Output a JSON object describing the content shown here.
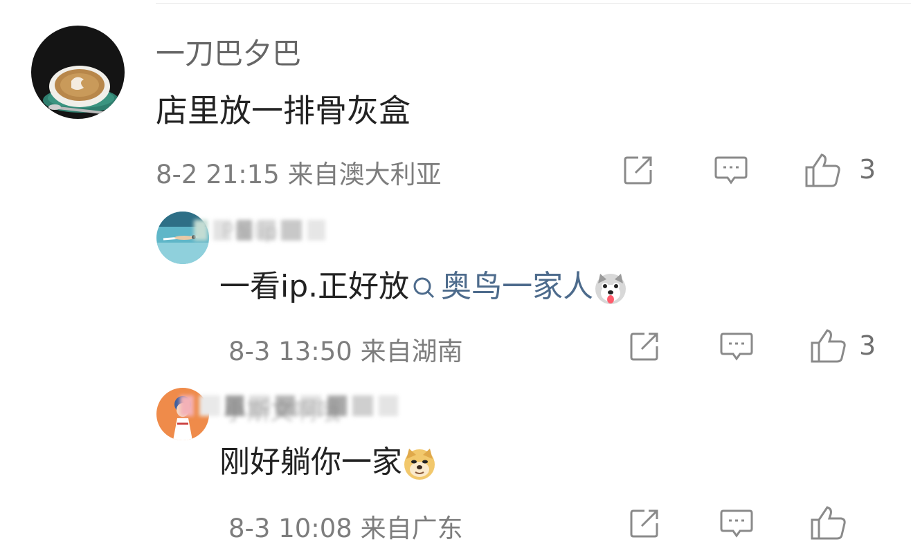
{
  "comments": [
    {
      "username": "一刀巴夕巴",
      "text": "店里放一排骨灰盒",
      "meta": "8-2 21:15 来自澳大利亚",
      "likes": "3",
      "avatar_icon": "coffee-latte-art-icon"
    },
    {
      "username": "Philip",
      "text_before": "一看ip.正好放",
      "search_term": "奥鸟一家人",
      "emoji_icon": "husky-dog-emoji-icon",
      "meta": "8-3 13:50 来自湖南",
      "likes": "3",
      "avatar_icon": "swimmer-pool-icon"
    },
    {
      "username": "小斯文啊哦",
      "text": "刚好躺你一家",
      "emoji_icon": "doge-emoji-icon",
      "meta": "8-3 10:08 来自广东",
      "likes": "",
      "avatar_icon": "anime-character-icon"
    }
  ],
  "icons": {
    "share": "share-square-icon",
    "reply": "comment-bubble-icon",
    "like": "thumbs-up-icon",
    "search": "search-icon"
  },
  "colors": {
    "username": "#666666",
    "text": "#222222",
    "meta": "#7d7d7d",
    "link": "#4d6b8c",
    "icon": "#8a8a8a"
  }
}
